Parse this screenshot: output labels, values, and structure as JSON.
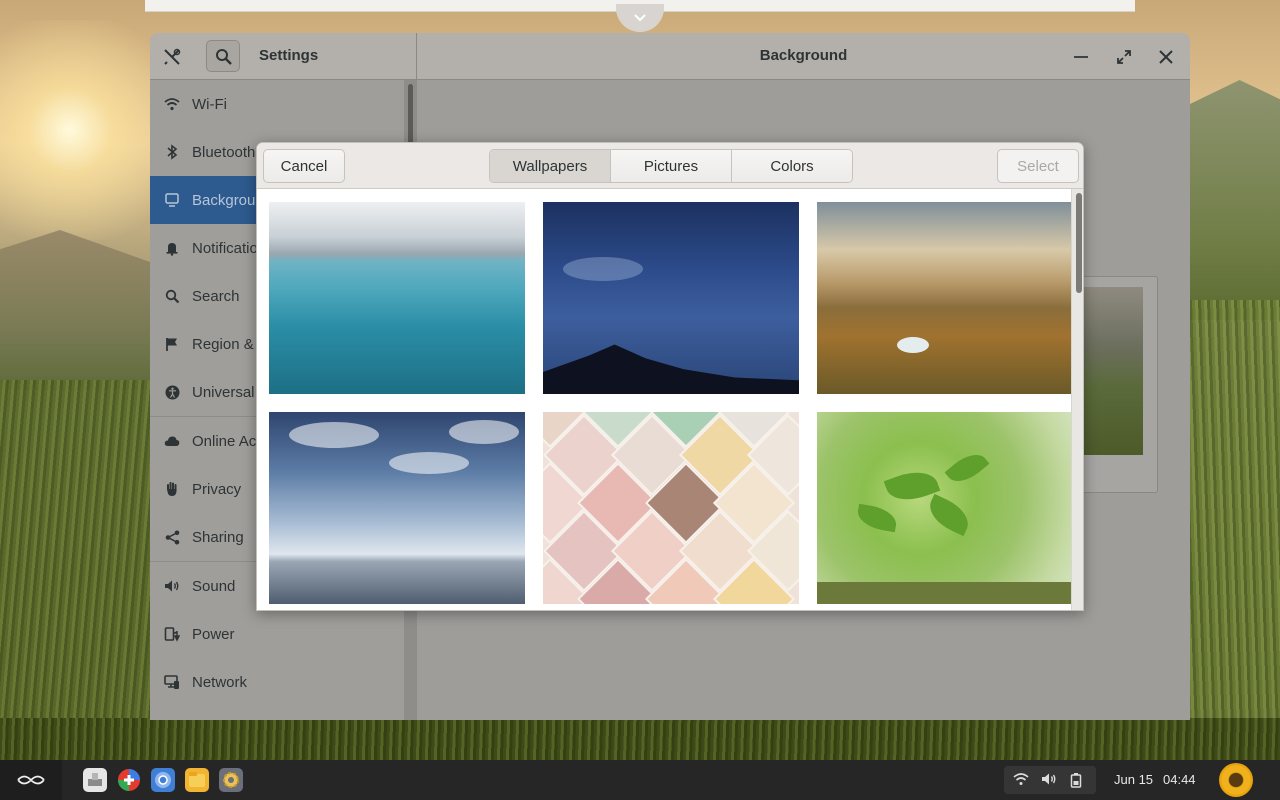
{
  "settings": {
    "title": "Settings",
    "panel_title": "Background",
    "sidebar": {
      "items": [
        {
          "label": "Wi-Fi",
          "icon": "wifi-icon"
        },
        {
          "label": "Bluetooth",
          "icon": "bluetooth-icon"
        },
        {
          "label": "Background",
          "icon": "display-icon",
          "active": true
        },
        {
          "label": "Notifications",
          "icon": "bell-icon"
        },
        {
          "label": "Search",
          "icon": "search-icon"
        },
        {
          "label": "Region & Language",
          "icon": "flag-icon"
        },
        {
          "label": "Universal Access",
          "icon": "accessibility-icon"
        },
        {
          "label": "Online Accounts",
          "icon": "cloud-icon"
        },
        {
          "label": "Privacy",
          "icon": "hand-icon"
        },
        {
          "label": "Sharing",
          "icon": "share-icon"
        },
        {
          "label": "Sound",
          "icon": "speaker-icon"
        },
        {
          "label": "Power",
          "icon": "power-plug-icon"
        },
        {
          "label": "Network",
          "icon": "network-icon"
        }
      ]
    }
  },
  "dialog": {
    "cancel_label": "Cancel",
    "select_label": "Select",
    "tabs": [
      {
        "label": "Wallpapers",
        "active": true
      },
      {
        "label": "Pictures"
      },
      {
        "label": "Colors"
      }
    ],
    "wallpapers": [
      {
        "name": "wallpaper-sea"
      },
      {
        "name": "wallpaper-night-sky"
      },
      {
        "name": "wallpaper-hills"
      },
      {
        "name": "wallpaper-sky-ocean"
      },
      {
        "name": "wallpaper-tiles"
      },
      {
        "name": "wallpaper-leaves"
      }
    ]
  },
  "taskbar": {
    "date": "Jun 15",
    "time": "04:44",
    "apps": [
      "files-app-icon",
      "software-center-icon",
      "chromium-icon",
      "file-manager-icon",
      "settings-app-icon"
    ]
  },
  "colors": {
    "accent_active": "#2d5a8f",
    "taskbar": "#262626"
  }
}
